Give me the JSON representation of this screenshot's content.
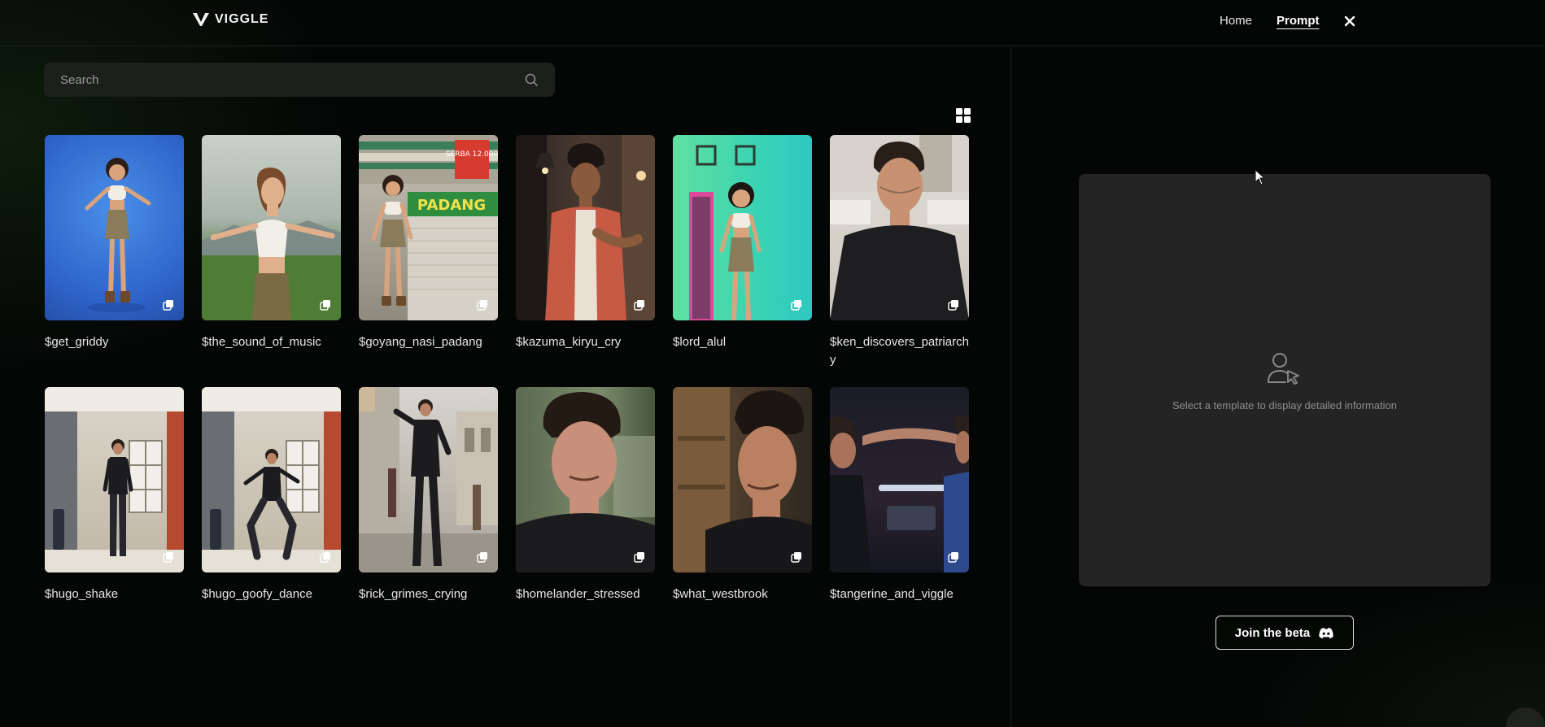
{
  "header": {
    "brand": "VIGGLE",
    "nav": {
      "home": "Home",
      "prompt": "Prompt"
    }
  },
  "search": {
    "placeholder": "Search"
  },
  "templates": [
    {
      "label": "$get_griddy"
    },
    {
      "label": "$the_sound_of_music"
    },
    {
      "label": "$goyang_nasi_padang",
      "sign_text": "PADANG",
      "sign_small": "SERBA 12.000"
    },
    {
      "label": "$kazuma_kiryu_cry"
    },
    {
      "label": "$lord_alul"
    },
    {
      "label": "$ken_discovers_patriarchy"
    },
    {
      "label": "$hugo_shake"
    },
    {
      "label": "$hugo_goofy_dance"
    },
    {
      "label": "$rick_grimes_crying"
    },
    {
      "label": "$homelander_stressed"
    },
    {
      "label": "$what_westbrook"
    },
    {
      "label": "$tangerine_and_viggle"
    }
  ],
  "detail": {
    "empty_message": "Select a template to display detailed information"
  },
  "join": {
    "label": "Join the beta"
  },
  "colors": {
    "background": "#040605",
    "panel": "#242424",
    "search_bg": "#1c1f1c"
  }
}
